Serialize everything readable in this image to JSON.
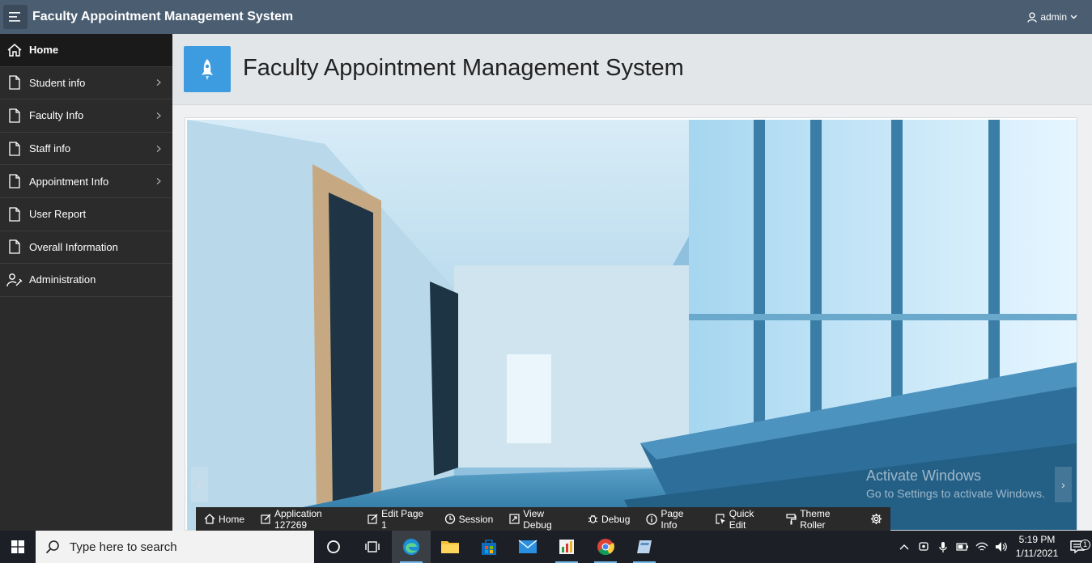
{
  "header": {
    "title": "Faculty Appointment Management System",
    "user": "admin"
  },
  "sidebar": {
    "items": [
      {
        "label": "Home",
        "icon": "home-icon",
        "active": true,
        "has_children": false
      },
      {
        "label": "Student info",
        "icon": "page-icon",
        "has_children": true
      },
      {
        "label": "Faculty Info",
        "icon": "page-icon",
        "has_children": true
      },
      {
        "label": "Staff info",
        "icon": "page-icon",
        "has_children": true
      },
      {
        "label": "Appointment Info",
        "icon": "page-icon",
        "has_children": true
      },
      {
        "label": "User Report",
        "icon": "page-icon",
        "has_children": false
      },
      {
        "label": "Overall Information",
        "icon": "page-icon",
        "has_children": false
      },
      {
        "label": "Administration",
        "icon": "wrench-user-icon",
        "has_children": false
      }
    ]
  },
  "hero": {
    "title": "Faculty Appointment Management System",
    "icon": "rocket-icon",
    "icon_color": "#3d9be0"
  },
  "carousel": {
    "image": "hospital-corridor-photo",
    "prev_glyph": "‹",
    "next_glyph": "›"
  },
  "watermark": {
    "line1": "Activate Windows",
    "line2": "Go to Settings to activate Windows."
  },
  "dev_toolbar": {
    "items": [
      {
        "label": "Home",
        "icon": "home-icon"
      },
      {
        "label": "Application 127269",
        "icon": "edit-icon"
      },
      {
        "label": "Edit Page 1",
        "icon": "edit-icon"
      },
      {
        "label": "Session",
        "icon": "session-icon"
      },
      {
        "label": "View Debug",
        "icon": "view-debug-icon"
      },
      {
        "label": "Debug",
        "icon": "bug-icon"
      },
      {
        "label": "Page Info",
        "icon": "info-icon"
      },
      {
        "label": "Quick Edit",
        "icon": "quick-edit-icon"
      },
      {
        "label": "Theme Roller",
        "icon": "paint-roller-icon"
      },
      {
        "label": "",
        "icon": "gear-icon"
      }
    ]
  },
  "taskbar": {
    "search_placeholder": "Type here to search",
    "time": "5:19 PM",
    "date": "1/11/2021",
    "notification_count": "1"
  },
  "colors": {
    "header": "#4a5d71",
    "sidebar": "#2b2b2b",
    "accent": "#3d9be0"
  }
}
